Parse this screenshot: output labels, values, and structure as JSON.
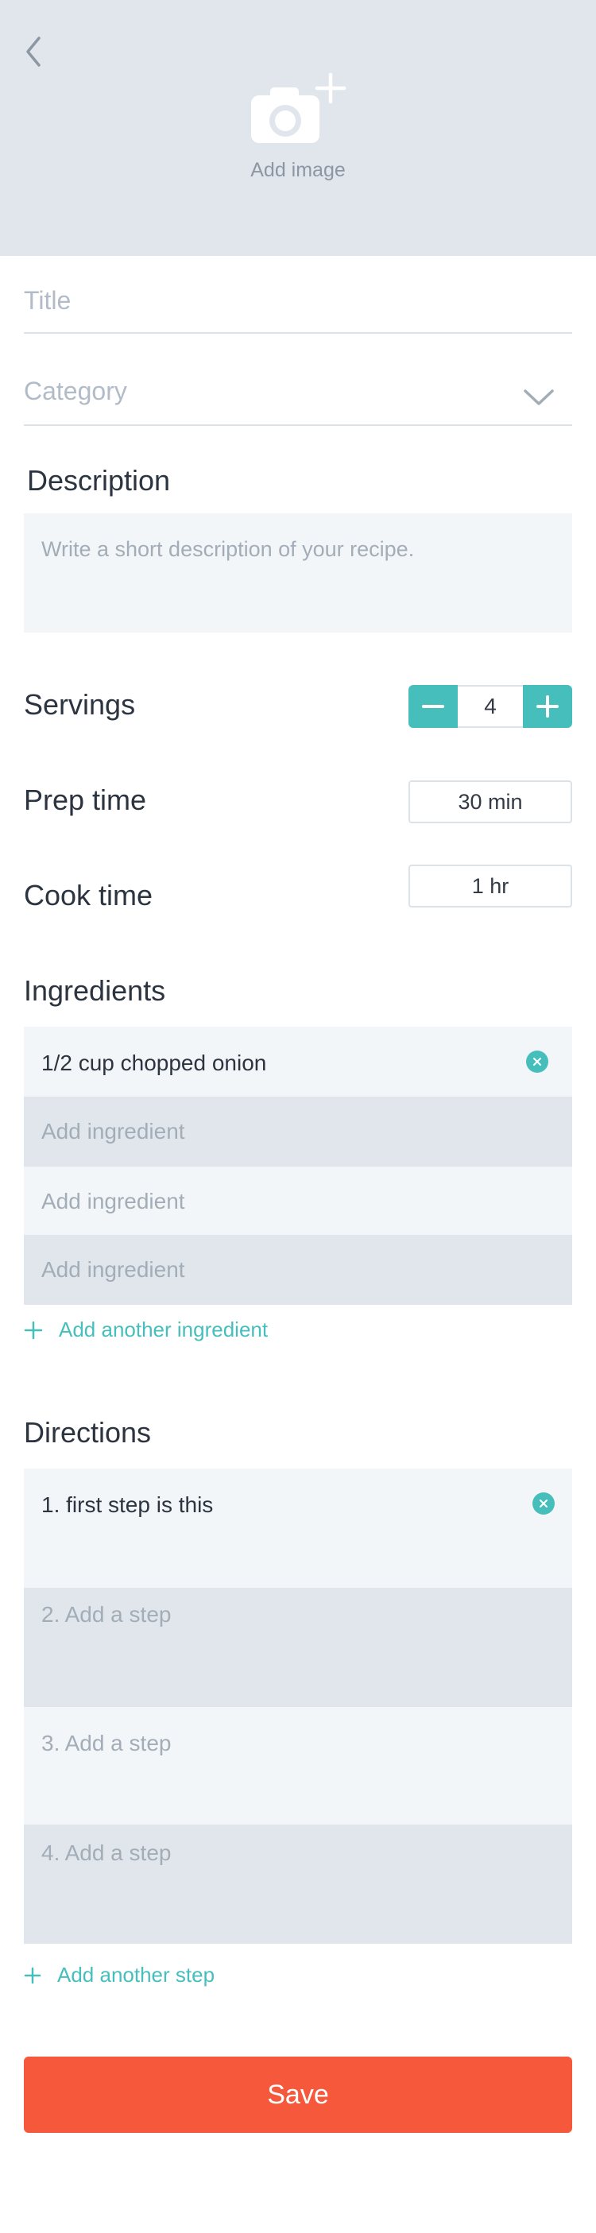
{
  "header": {
    "back_icon": "chevron-left-icon",
    "add_image_label": "Add image",
    "camera_icon": "camera-plus-icon"
  },
  "form": {
    "title_placeholder": "Title",
    "category_placeholder": "Category",
    "description_label": "Description",
    "description_placeholder": "Write a short description of your recipe."
  },
  "servings": {
    "label": "Servings",
    "value": "4"
  },
  "prep_time": {
    "label": "Prep time",
    "value": "30 min"
  },
  "cook_time": {
    "label": "Cook time",
    "value": "1 hr"
  },
  "ingredients": {
    "title": "Ingredients",
    "items": [
      {
        "text": "1/2 cup chopped onion",
        "filled": true
      },
      {
        "text": "Add ingredient",
        "filled": false
      },
      {
        "text": "Add ingredient",
        "filled": false
      },
      {
        "text": "Add ingredient",
        "filled": false
      }
    ],
    "add_label": "Add another ingredient"
  },
  "directions": {
    "title": "Directions",
    "steps": [
      {
        "text": "1. first step is this",
        "filled": true
      },
      {
        "text": "2. Add a step",
        "filled": false
      },
      {
        "text": "3. Add a step",
        "filled": false
      },
      {
        "text": "4. Add a step",
        "filled": false
      }
    ],
    "add_label": "Add another step"
  },
  "save_label": "Save",
  "colors": {
    "accent": "#46bfbc",
    "save": "#f5583b",
    "header_bg": "#e0e6ec",
    "row_light": "#f3f6f9",
    "row_dark": "#e0e6ec"
  }
}
